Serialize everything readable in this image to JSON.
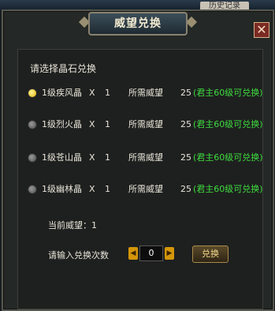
{
  "background": {
    "tab_label": "历史记录"
  },
  "dialog": {
    "title": "威望兑换",
    "close_symbol": "✕",
    "prompt": "请选择晶石兑换",
    "items": [
      {
        "name": "1级疾风晶",
        "x": "X",
        "qty": "1",
        "req_label": "所需威望",
        "req_value": "25",
        "note": "(君主60级可兑换)",
        "selected": true
      },
      {
        "name": "1级烈火晶",
        "x": "X",
        "qty": "1",
        "req_label": "所需威望",
        "req_value": "25",
        "note": "(君主60级可兑换)",
        "selected": false
      },
      {
        "name": "1级苍山晶",
        "x": "X",
        "qty": "1",
        "req_label": "所需威望",
        "req_value": "25",
        "note": "(君主60级可兑换)",
        "selected": false
      },
      {
        "name": "1级幽林晶",
        "x": "X",
        "qty": "1",
        "req_label": "所需威望",
        "req_value": "25",
        "note": "(君主60级可兑换)",
        "selected": false
      }
    ],
    "current_prestige_label": "当前威望：",
    "current_prestige_value": "1",
    "count_label": "请输入兑换次数",
    "count_value": "0",
    "exchange_button": "兑换"
  },
  "colors": {
    "note_green": "#3fdc3f",
    "radio_selected": "#e0b000",
    "stepper": "#d4960a"
  }
}
